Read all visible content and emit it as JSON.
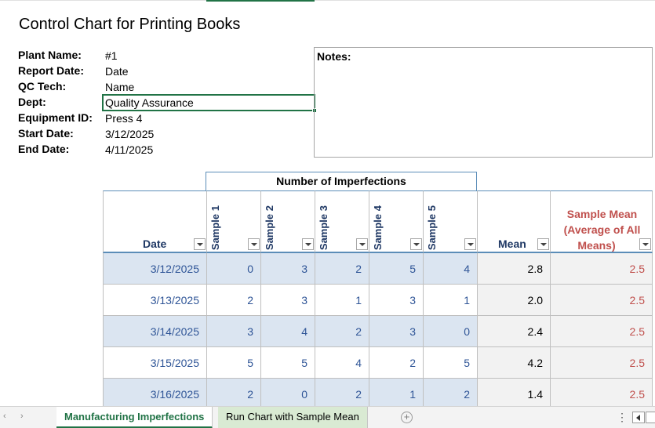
{
  "title": "Control Chart for Printing Books",
  "info": [
    {
      "label": "Plant Name:",
      "value": "#1"
    },
    {
      "label": "Report Date:",
      "value": "Date"
    },
    {
      "label": "QC Tech:",
      "value": "Name"
    },
    {
      "label": "Dept:",
      "value": "Quality Assurance"
    },
    {
      "label": "Equipment ID:",
      "value": "Press 4"
    },
    {
      "label": "Start Date:",
      "value": "3/12/2025"
    },
    {
      "label": "End Date:",
      "value": "4/11/2025"
    }
  ],
  "notes_label": "Notes:",
  "group_header": "Number of Imperfections",
  "columns": {
    "date": "Date",
    "samples": [
      "Sample 1",
      "Sample 2",
      "Sample 3",
      "Sample 4",
      "Sample 5"
    ],
    "mean": "Mean",
    "sample_mean_lines": [
      "Sample Mean",
      "(Average of All",
      "Means)"
    ]
  },
  "rows": [
    {
      "date": "3/12/2025",
      "s": [
        "0",
        "3",
        "2",
        "5",
        "4"
      ],
      "mean": "2.8",
      "smean": "2.5"
    },
    {
      "date": "3/13/2025",
      "s": [
        "2",
        "3",
        "1",
        "3",
        "1"
      ],
      "mean": "2.0",
      "smean": "2.5"
    },
    {
      "date": "3/14/2025",
      "s": [
        "3",
        "4",
        "2",
        "3",
        "0"
      ],
      "mean": "2.4",
      "smean": "2.5"
    },
    {
      "date": "3/15/2025",
      "s": [
        "5",
        "5",
        "4",
        "2",
        "5"
      ],
      "mean": "4.2",
      "smean": "2.5"
    },
    {
      "date": "3/16/2025",
      "s": [
        "2",
        "0",
        "2",
        "1",
        "2"
      ],
      "mean": "1.4",
      "smean": "2.5"
    }
  ],
  "tabs": {
    "active": "Manufacturing Imperfections",
    "inactive": "Run Chart with Sample Mean",
    "add": "+",
    "more": "⋮"
  },
  "colors": {
    "accent": "#217346",
    "header_text": "#1f3864",
    "value_text": "#2f5597",
    "sample_mean_text": "#c0504d",
    "band": "#dbe5f1"
  }
}
